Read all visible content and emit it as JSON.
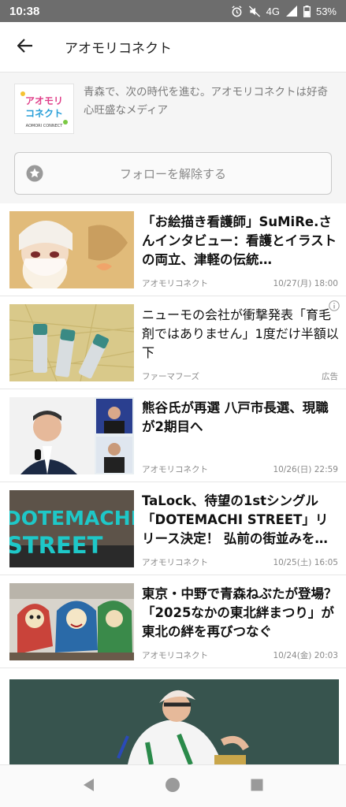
{
  "status_bar": {
    "time": "10:38",
    "network": "4G",
    "battery": "53%",
    "icons": [
      "alarm-icon",
      "mute-icon",
      "signal-icon",
      "battery-icon"
    ]
  },
  "app_bar": {
    "title": "アオモリコネクト",
    "back_icon": "arrow-left-icon"
  },
  "channel": {
    "logo_text": [
      "アオモリ",
      "コネクト"
    ],
    "logo_subtext": "AOMORI CONNECT",
    "description": "青森で、次の時代を進む。アオモリコネクトは好奇心旺盛なメディア",
    "follow_button_label": "フォローを解除する",
    "follow_icon": "star-icon"
  },
  "articles": [
    {
      "headline": "「お絵描き看護師」SuMiRe.さんインタビュー：看護とイラストの両立、津軽の伝統…",
      "source": "アオモリコネクト",
      "date": "10/27(月) 18:00",
      "is_ad": false
    },
    {
      "headline": "ニューモの会社が衝撃発表「育毛剤ではありません」1度だけ半額以下",
      "source": "ファーマフーズ",
      "date": "広告",
      "is_ad": true
    },
    {
      "headline": "熊谷氏が再選 八戸市長選、現職が2期目へ",
      "source": "アオモリコネクト",
      "date": "10/26(日) 22:59",
      "is_ad": false
    },
    {
      "headline": "TaLock、待望の1stシングル「DOTEMACHI STREET」リリース決定！ 弘前の街並みを…",
      "source": "アオモリコネクト",
      "date": "10/25(土) 16:05",
      "is_ad": false,
      "thumb_text": [
        "DOTEMACHI",
        "STREET"
      ]
    },
    {
      "headline": "東京・中野で青森ねぶたが登場？「2025なかの東北絆まつり」が東北の絆を再びつなぐ",
      "source": "アオモリコネクト",
      "date": "10/24(金) 20:03",
      "is_ad": false
    }
  ],
  "bottom_ad": {
    "info_icon": "info-icon"
  },
  "nav_bar": {
    "buttons": [
      "back-triangle-icon",
      "home-circle-icon",
      "recents-square-icon"
    ]
  },
  "colors": {
    "status_bar": "#6d6d6d",
    "channel_bg": "#f5f5f5",
    "text_muted": "#8a8a8a",
    "accent_teal": "#1ec8c8"
  }
}
